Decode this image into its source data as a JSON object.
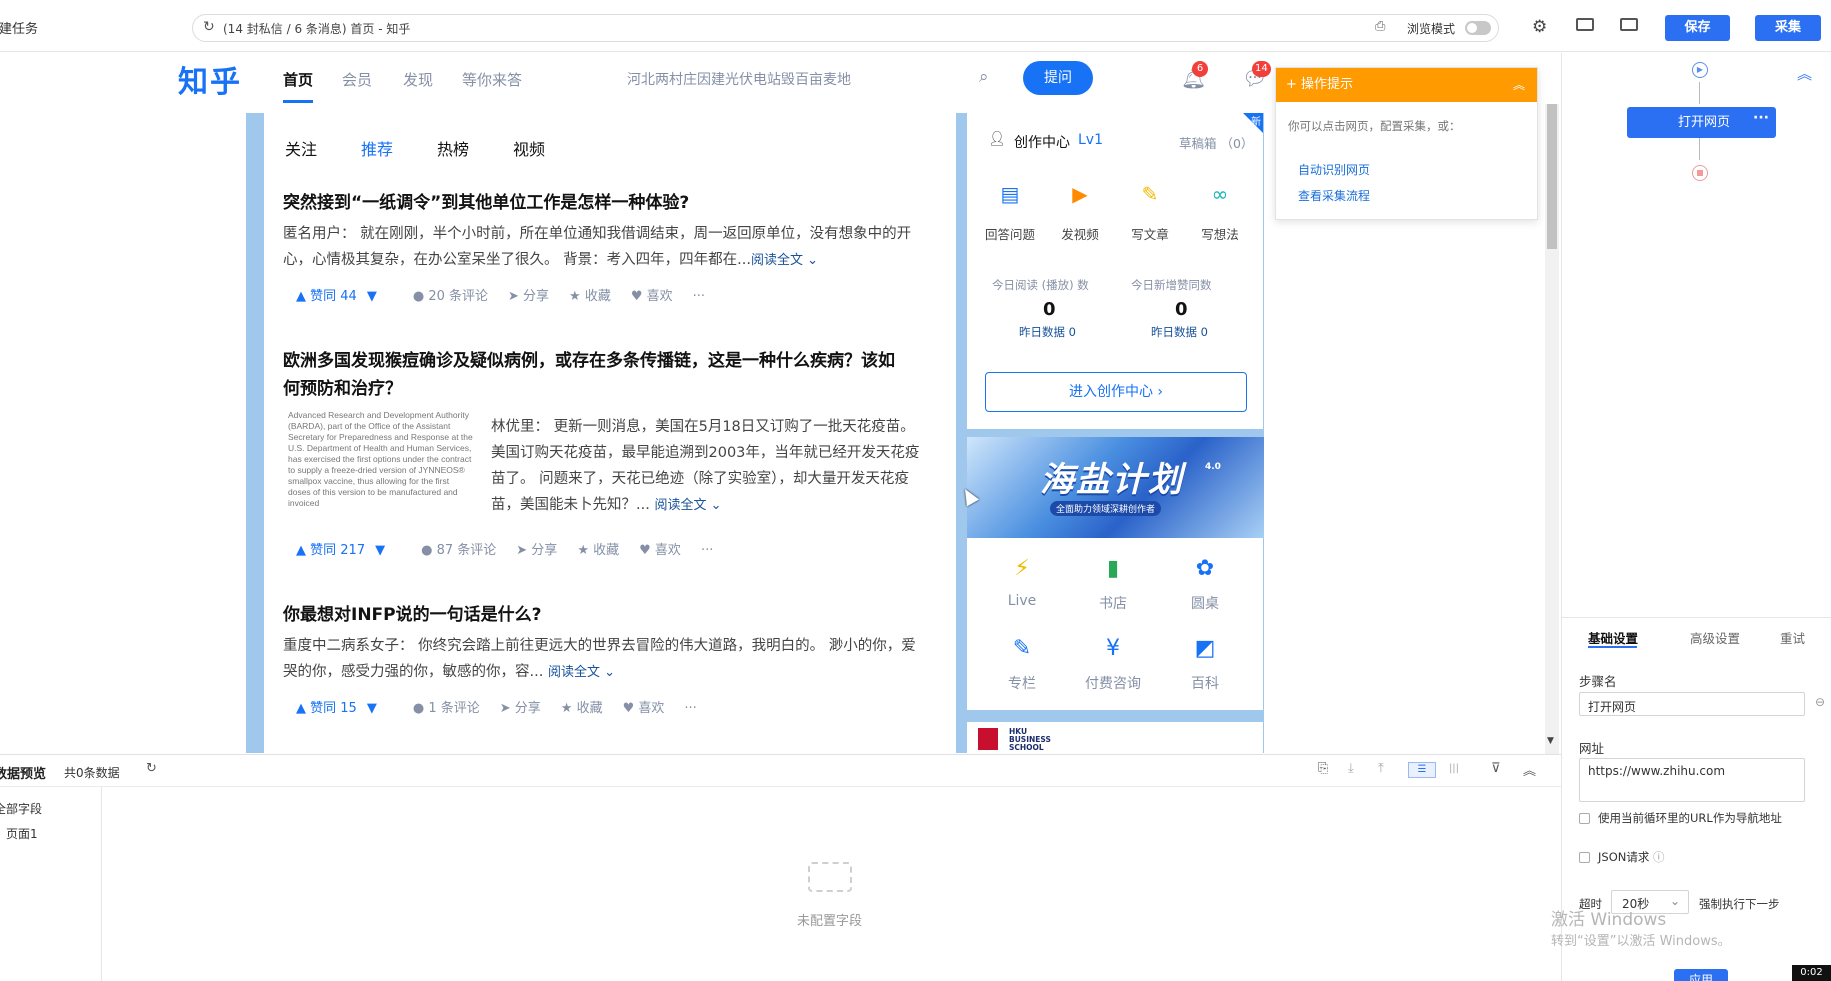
{
  "app": {
    "new_task": "新建任务",
    "url_title": "(14 封私信 / 6 条消息) 首页 - 知乎",
    "browse_mode": "浏览模式",
    "save": "保存",
    "collect": "采集"
  },
  "zhihu": {
    "logo": "知乎",
    "nav": [
      "首页",
      "会员",
      "发现",
      "等你来答"
    ],
    "search_hot": "河北两村庄因建光伏电站毁百亩麦地",
    "ask": "提问",
    "notif_badge": "6",
    "msg_badge": "14",
    "tabs": [
      "关注",
      "推荐",
      "热榜",
      "视频"
    ],
    "feed": [
      {
        "title": "突然接到“一纸调令”到其他单位工作是怎样一种体验?",
        "excerpt_1": "匿名用户： 就在刚刚，半个小时前，所在单位通知我借调结束，周一返回原单位，没有想象中的开",
        "excerpt_2": "心，心情极其复杂，在办公室呆坐了很久。 背景：考入四年，四年都在...",
        "read_more": "阅读全文",
        "vote": "赞同 44",
        "comments": "20 条评论",
        "share": "分享",
        "fav": "收藏",
        "like": "喜欢",
        "more": "···"
      },
      {
        "title_1": "欧洲多国发现猴痘确诊及疑似病例，或存在多条传播链，这是一种什么疾病？该如",
        "title_2": "何预防和治疗？",
        "thumb_text": "Advanced Research and Development Authority (BARDA), part of the Office of the Assistant Secretary for Preparedness and Response at the U.S. Department of Health and Human Services, has exercised the first options under the contract to supply a freeze-dried version of JYNNEOS® smallpox vaccine, thus allowing for the first doses of this version to be manufactured and invoiced",
        "excerpt_1": "林优里： 更新一则消息，美国在5月18日又订购了一批天花疫苗。",
        "excerpt_2": "美国订购天花疫苗，最早能追溯到2003年，当年就已经开发天花疫",
        "excerpt_3": "苗了。 问题来了，天花已绝迹（除了实验室），却大量开发天花疫",
        "excerpt_4": "苗，美国能未卜先知？...",
        "read_more": "阅读全文",
        "vote": "赞同 217",
        "comments": "87 条评论",
        "share": "分享",
        "fav": "收藏",
        "like": "喜欢",
        "more": "···"
      },
      {
        "title": "你最想对INFP说的一句话是什么?",
        "excerpt_1": "重度中二病系女子： 你终究会踏上前往更远大的世界去冒险的伟大道路，我明白的。 渺小的你，爱",
        "excerpt_2": "哭的你，感受力强的你，敏感的你，容...",
        "read_more": "阅读全文",
        "vote": "赞同 15",
        "comments": "1 条评论",
        "share": "分享",
        "fav": "收藏",
        "like": "喜欢",
        "more": "···"
      }
    ],
    "creator": {
      "title": "创作中心",
      "level": "Lv1",
      "draft": "草稿箱 （0）",
      "new_tag": "新",
      "quick": [
        "回答问题",
        "发视频",
        "写文章",
        "写想法"
      ],
      "stat1_label": "今日阅读 (播放) 数",
      "stat1_value": "0",
      "stat1_sub": "昨日数据 0",
      "stat2_label": "今日新增赞同数",
      "stat2_value": "0",
      "stat2_sub": "昨日数据 0",
      "enter": "进入创作中心 ›"
    },
    "banner": {
      "title": "海盐计划",
      "version": "4.0",
      "subtitle": "全面助力领域深耕创作者"
    },
    "services": [
      "Live",
      "书店",
      "圆桌",
      "专栏",
      "付费咨询",
      "百科"
    ],
    "hku": "HKU BUSINESS SCHOOL"
  },
  "hint": {
    "title": "操作提示",
    "desc": "你可以点击网页，配置采集，或：",
    "link1": "自动识别网页",
    "link2": "查看采集流程"
  },
  "flow": {
    "open_page": "打开网页",
    "more": "···"
  },
  "settings": {
    "tabs": [
      "基础设置",
      "高级设置",
      "重试"
    ],
    "step_name_label": "步骤名",
    "step_name_value": "打开网页",
    "url_label": "网址",
    "url_value": "https://www.zhihu.com",
    "use_loop_url": "使用当前循环里的URL作为导航地址",
    "json_req": "JSON请求",
    "timeout_label": "超时",
    "timeout_value": "20秒",
    "force_next": "强制执行下一步",
    "apply": "应用"
  },
  "bottom": {
    "title": "数据预览",
    "count": "共0条数据",
    "all_fields": "全部字段",
    "page1": "页面1",
    "empty": "未配置字段"
  },
  "watermark": {
    "line1": "激活 Windows",
    "line2": "转到“设置”以激活 Windows。"
  },
  "clock": "0:02",
  "colors": {
    "zhihu_blue": "#1772f6",
    "tool_blue": "#2b6ff3",
    "hint_orange": "#ff9a00",
    "side_blue": "#9fc8ec"
  }
}
